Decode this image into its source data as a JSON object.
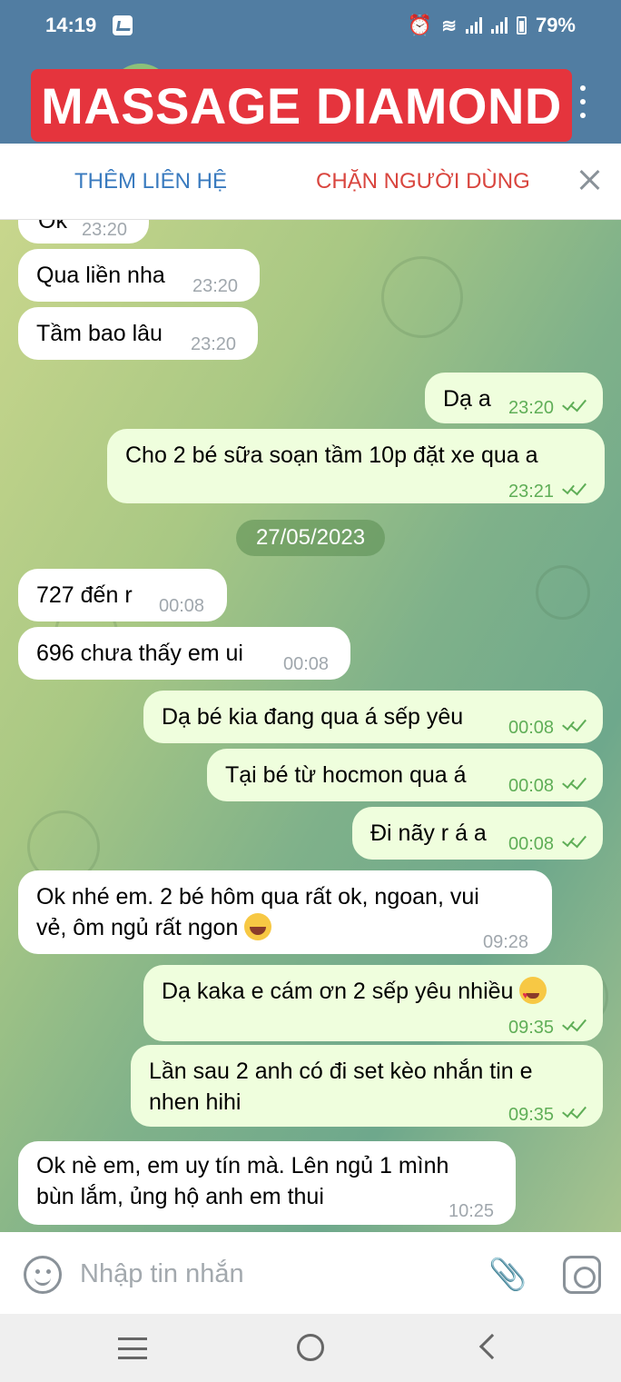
{
  "status_bar": {
    "time": "14:19",
    "battery": "79%"
  },
  "header": {
    "title": "MASSAGE DIAMOND"
  },
  "action_bar": {
    "add_contact": "THÊM LIÊN HỆ",
    "block_user": "CHẶN NGƯỜI DÙNG"
  },
  "messages": [
    {
      "dir": "in",
      "text": "Ok",
      "time": "23:20"
    },
    {
      "dir": "in",
      "text": "Qua liền nha",
      "time": "23:20"
    },
    {
      "dir": "in",
      "text": "Tầm bao lâu",
      "time": "23:20"
    },
    {
      "dir": "out",
      "text": "Dạ a",
      "time": "23:20"
    },
    {
      "dir": "out",
      "text": "Cho 2 bé sữa soạn tầm 10p đặt xe qua a",
      "time": "23:21"
    },
    {
      "dir": "in",
      "text": "727 đến r",
      "time": "00:08"
    },
    {
      "dir": "in",
      "text": "696 chưa thấy em ui",
      "time": "00:08"
    },
    {
      "dir": "out",
      "text": "Dạ bé kia đang qua á sếp yêu",
      "time": "00:08"
    },
    {
      "dir": "out",
      "text": "Tại bé từ hocmon qua á",
      "time": "00:08"
    },
    {
      "dir": "out",
      "text": "Đi nãy r á a",
      "time": "00:08"
    },
    {
      "dir": "in",
      "text_line1": "Ok nhé em. 2 bé hôm qua rất ok, ngoan, vui",
      "text_line2": "vẻ, ôm ngủ rất ngon",
      "emoji": "face-with-tears-of-joy",
      "time": "09:28"
    },
    {
      "dir": "out",
      "text": "Dạ kaka e cám ơn 2 sếp yêu nhiều",
      "emoji": "heart-eyes",
      "time": "09:35"
    },
    {
      "dir": "out",
      "text_line1": "Lần sau 2 anh có đi set kèo nhắn tin e",
      "text_line2": "nhen hihi",
      "time": "09:35"
    },
    {
      "dir": "in",
      "text_line1": "Ok nè em, em uy tín mà. Lên ngủ 1 mình",
      "text_line2": "bùn lắm, ủng hộ anh em thui",
      "time": "10:25"
    }
  ],
  "date_separator": "27/05/2023",
  "composer": {
    "placeholder": "Nhập tin nhắn"
  },
  "icons": {
    "status": [
      "gallery-icon",
      "alarm-icon",
      "wifi-icon",
      "signal-icon",
      "signal-icon",
      "battery-icon"
    ],
    "composer": [
      "emoji-icon",
      "paperclip-icon",
      "camera-icon"
    ],
    "nav": [
      "recents-icon",
      "home-icon",
      "back-icon"
    ]
  },
  "colors": {
    "header": "#517da2",
    "banner": "#e5343d",
    "outgoing_bubble": "#effedd",
    "incoming_bubble": "#ffffff",
    "read_tick": "#5fae57"
  }
}
